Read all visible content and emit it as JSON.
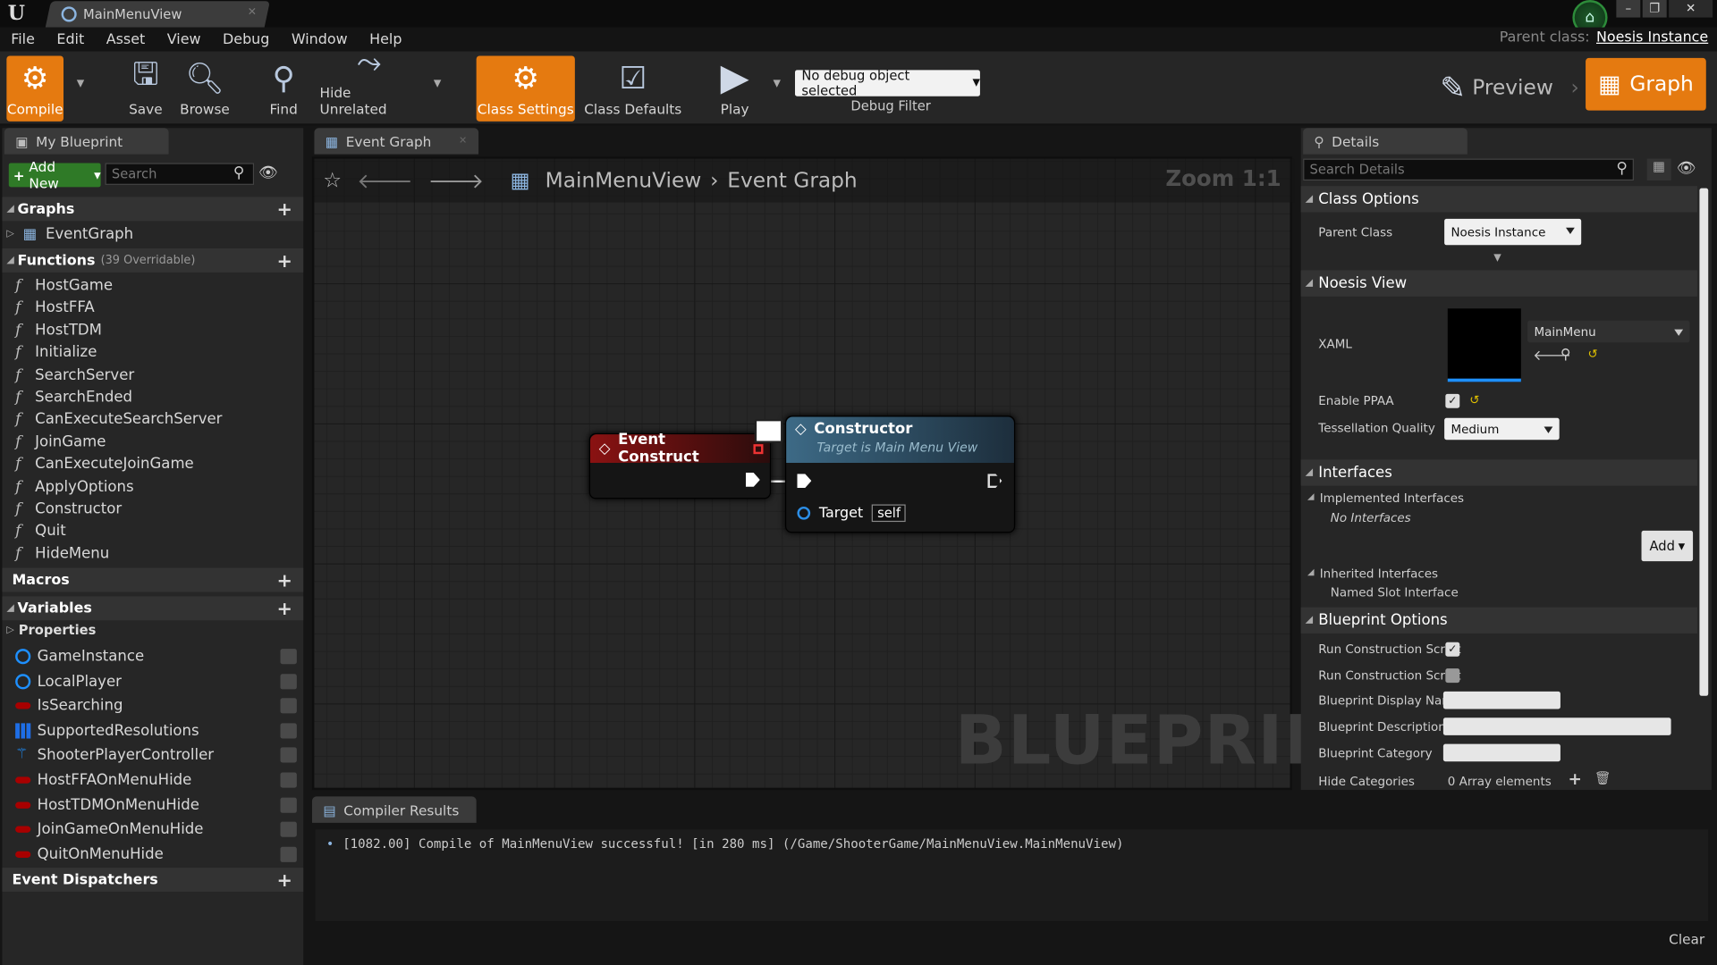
{
  "window": {
    "doc_tab": "MainMenuView",
    "parent_class_label": "Parent class:",
    "parent_class_value": "Noesis Instance"
  },
  "menu": [
    "File",
    "Edit",
    "Asset",
    "View",
    "Debug",
    "Window",
    "Help"
  ],
  "toolbar": {
    "compile": "Compile",
    "save": "Save",
    "browse": "Browse",
    "find": "Find",
    "hide_unrelated": "Hide Unrelated",
    "class_settings": "Class Settings",
    "class_defaults": "Class Defaults",
    "play": "Play",
    "debug_select": "No debug object selected",
    "debug_filter": "Debug Filter",
    "preview": "Preview",
    "graph": "Graph"
  },
  "my_blueprint": {
    "tab": "My Blueprint",
    "add_new": "Add New",
    "search_placeholder": "Search",
    "graphs_header": "Graphs",
    "graphs": [
      "EventGraph"
    ],
    "functions_header": "Functions",
    "functions_sub": "(39 Overridable)",
    "functions": [
      "HostGame",
      "HostFFA",
      "HostTDM",
      "Initialize",
      "SearchServer",
      "SearchEnded",
      "CanExecuteSearchServer",
      "JoinGame",
      "CanExecuteJoinGame",
      "ApplyOptions",
      "Constructor",
      "Quit",
      "HideMenu"
    ],
    "macros_header": "Macros",
    "variables_header": "Variables",
    "properties_header": "Properties",
    "variables": [
      {
        "name": "GameInstance",
        "type_color": "#1e90ff",
        "icon": "object-circle-icon"
      },
      {
        "name": "LocalPlayer",
        "type_color": "#1e90ff",
        "icon": "object-circle-icon"
      },
      {
        "name": "IsSearching",
        "type_color": "#a80000",
        "icon": "bool-pill-icon"
      },
      {
        "name": "SupportedResolutions",
        "type_color": "#1e6ee6",
        "icon": "array-grid-icon"
      },
      {
        "name": "ShooterPlayerController",
        "type_color": "#1e90ff",
        "icon": "class-icon"
      },
      {
        "name": "HostFFAOnMenuHide",
        "type_color": "#a80000",
        "icon": "bool-pill-icon"
      },
      {
        "name": "HostTDMOnMenuHide",
        "type_color": "#a80000",
        "icon": "bool-pill-icon"
      },
      {
        "name": "JoinGameOnMenuHide",
        "type_color": "#a80000",
        "icon": "bool-pill-icon"
      },
      {
        "name": "QuitOnMenuHide",
        "type_color": "#a80000",
        "icon": "bool-pill-icon"
      }
    ],
    "dispatchers_header": "Event Dispatchers"
  },
  "graph": {
    "tab": "Event Graph",
    "breadcrumb_root": "MainMenuView",
    "breadcrumb_leaf": "Event Graph",
    "zoom": "Zoom 1:1",
    "watermark": "BLUEPRINT",
    "event_node_title": "Event Construct",
    "event_node_color": "#8a1212",
    "call_node_title": "Constructor",
    "call_node_subtitle": "Target is Main Menu View",
    "call_node_color": "#3d6a86",
    "target_label": "Target",
    "target_value": "self"
  },
  "compiler": {
    "tab": "Compiler Results",
    "message": "[1082.00] Compile of MainMenuView successful! [in 280 ms] (/Game/ShooterGame/MainMenuView.MainMenuView)",
    "clear": "Clear"
  },
  "details": {
    "tab": "Details",
    "search_placeholder": "Search Details",
    "class_options": "Class Options",
    "parent_class_label": "Parent Class",
    "parent_class_value": "Noesis Instance",
    "noesis_view": "Noesis View",
    "xaml_label": "XAML",
    "xaml_value": "MainMenu",
    "enable_ppaa_label": "Enable PPAA",
    "enable_ppaa": true,
    "tess_label": "Tessellation Quality",
    "tess_value": "Medium",
    "interfaces": "Interfaces",
    "implemented": "Implemented Interfaces",
    "no_interfaces": "No Interfaces",
    "add": "Add",
    "inherited": "Inherited Interfaces",
    "named_slot": "Named Slot Interface",
    "bp_options": "Blueprint Options",
    "run_cs_1": "Run Construction Script",
    "run_cs_1_checked": true,
    "run_cs_2": "Run Construction Script",
    "run_cs_2_checked": false,
    "display_name": "Blueprint Display Name",
    "description": "Blueprint Description",
    "category": "Blueprint Category",
    "hide_categories": "Hide Categories",
    "array_elements": "0 Array elements"
  }
}
